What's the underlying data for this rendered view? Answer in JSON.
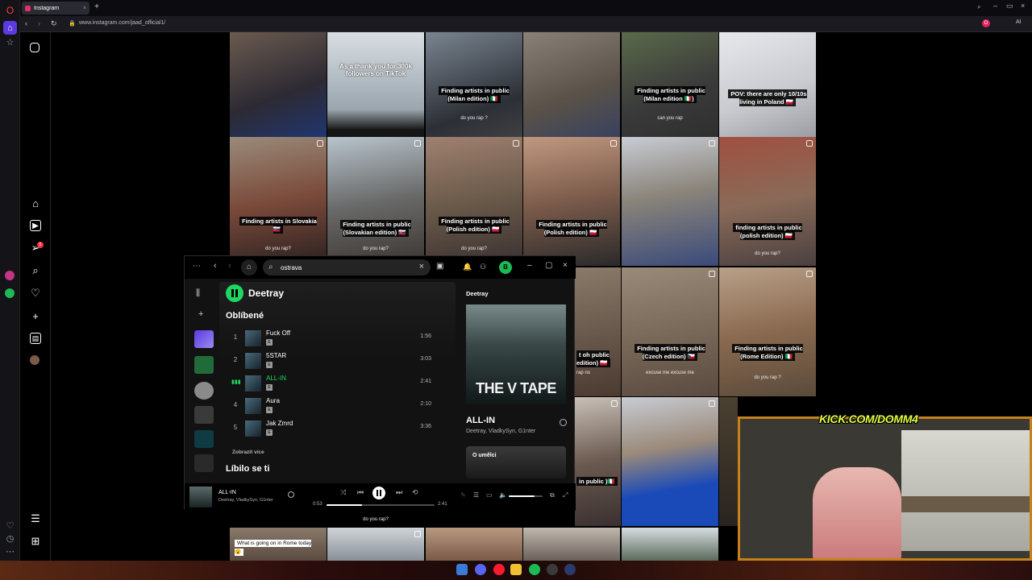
{
  "browser": {
    "tab_title": "Instagram",
    "url": "www.instagram.com/jaad_official1/"
  },
  "grid": {
    "row1": [
      {
        "caption": ""
      },
      {
        "caption": "As a thank you for 300k followers on TikTok"
      },
      {
        "caption": "Finding artists in public (Milan edition) 🇮🇹",
        "sub": "do you rap ?"
      },
      {
        "caption": ""
      },
      {
        "caption": "Finding artists in public (Milan edition 🇮🇹)",
        "sub": "can you rap"
      },
      {
        "caption": "POV: there are only 10/10s living in Poland 🇵🇱"
      }
    ],
    "row2": [
      {
        "caption": "Finding artists in Slovakia 🇸🇰",
        "sub": "do you rap?"
      },
      {
        "caption": "Finding artists in public (Slovakian edition) 🇸🇰",
        "sub": "do you rap?"
      },
      {
        "caption": "Finding artists in public (Polish edition) 🇵🇱",
        "sub": "do you rap?"
      },
      {
        "caption": "Finding artists in public (Polish edition) 🇵🇱"
      },
      {
        "caption": ""
      },
      {
        "caption": "finding artists in public (polish edition) 🇵🇱",
        "sub": "do you rap?"
      }
    ],
    "row3": [
      {
        "caption": "t oh public edition) 🇵🇱",
        "sub": "rap no"
      },
      {
        "caption": "Finding artists in public (Czech edition) 🇨🇿",
        "sub": "excuse me excuse me"
      },
      {
        "caption": "Finding artists in public (Rome Edition) 🇮🇹",
        "sub": "do you rap ?"
      }
    ],
    "row4": [
      {
        "caption": "in public )🇮🇹"
      },
      {
        "caption": ""
      }
    ],
    "row5": [
      {
        "caption": "What is going on in Rome today 😮"
      }
    ],
    "extra_sub": "do you rap?"
  },
  "spotify": {
    "search_value": "ostrava",
    "avatar_letter": "B",
    "artist": "Deetray",
    "section_favorites": "Oblíbené",
    "tracks": [
      {
        "num": "1",
        "title": "Fuck Off",
        "explicit": "E",
        "duration": "1:56"
      },
      {
        "num": "2",
        "title": "5STAR",
        "explicit": "E",
        "duration": "3:03"
      },
      {
        "num": "",
        "title": "ALL-IN",
        "explicit": "E",
        "duration": "2:41"
      },
      {
        "num": "4",
        "title": "Aura",
        "explicit": "E",
        "duration": "2:10"
      },
      {
        "num": "5",
        "title": "Jak Zmrd",
        "explicit": "E",
        "duration": "3:36"
      }
    ],
    "show_more": "Zobrazit více",
    "section_liked": "Líbilo se ti",
    "right_panel": {
      "header": "Deetray",
      "album_title": "THE V TAPE",
      "track": "ALL-IN",
      "artists": "Deetray, VladkySyn, G1nter",
      "about": "O umělci"
    },
    "player": {
      "track": "ALL-IN",
      "artists": "Deetray, VladkySyn, G1nter",
      "elapsed": "0:53",
      "total": "2:41",
      "progress": 0.33,
      "volume": 0.75
    },
    "accent": "#1ed760"
  },
  "stream": {
    "overlay": "KICK.COM/DOMM4",
    "frame_color": "#c8801a"
  },
  "opera_badge": "5"
}
